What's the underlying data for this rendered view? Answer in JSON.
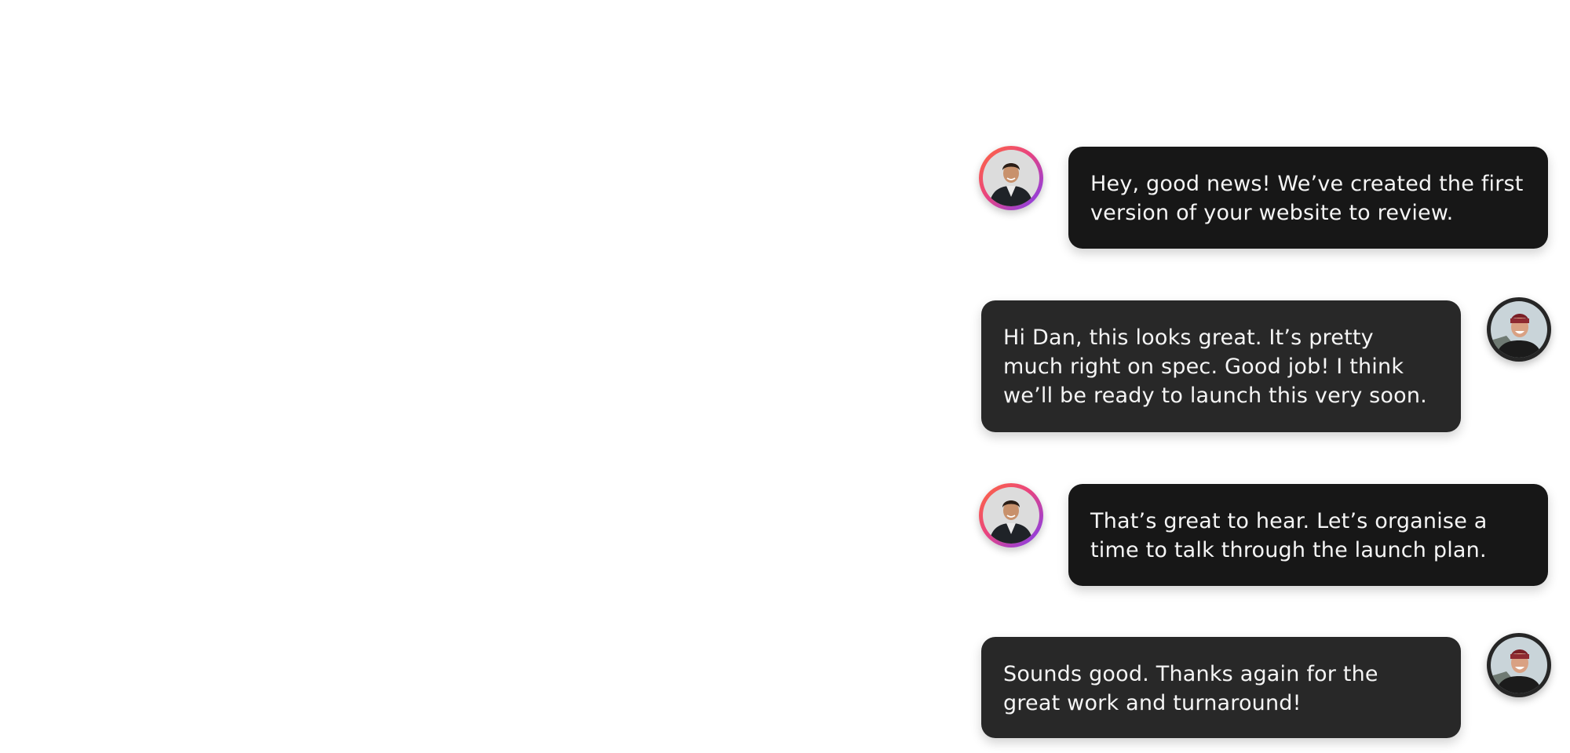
{
  "conversation": {
    "messages": [
      {
        "sender": "agent",
        "text": "Hey, good news! We’ve created the first version of your website to review.",
        "avatar_icon": "agent-avatar-icon"
      },
      {
        "sender": "client",
        "text": "Hi Dan, this looks great. It’s pretty much right on spec. Good job! I think we’ll be ready to launch this very soon.",
        "avatar_icon": "client-avatar-icon"
      },
      {
        "sender": "agent",
        "text": "That’s great to hear. Let’s organise a time to talk through the launch plan.",
        "avatar_icon": "agent-avatar-icon"
      },
      {
        "sender": "client",
        "text": "Sounds good. Thanks again for the great work and turnaround!",
        "avatar_icon": "client-avatar-icon"
      }
    ]
  },
  "colors": {
    "agent_bubble": "#171717",
    "client_bubble": "#282828",
    "bubble_text": "#f5f5f5",
    "agent_avatar_ring": [
      "#ff6a3d",
      "#e9447f",
      "#7a3df5"
    ],
    "client_avatar_ring": "#262626",
    "background": "#ffffff"
  }
}
